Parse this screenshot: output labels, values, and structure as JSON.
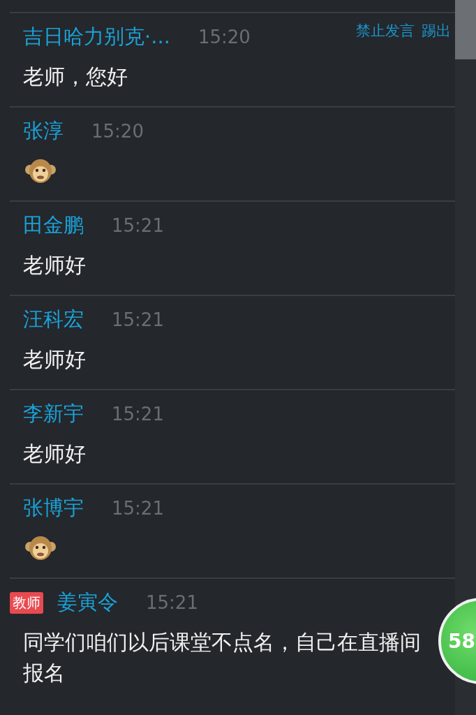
{
  "messages": [
    {
      "sender": "吉日哈力别克·...",
      "time": "15:20",
      "kind": "text",
      "body": "老师，您好",
      "actions": [
        "禁止发言",
        "踢出"
      ]
    },
    {
      "sender": "张淳",
      "time": "15:20",
      "kind": "sticker"
    },
    {
      "sender": "田金鹏",
      "time": "15:21",
      "kind": "text",
      "body": "老师好"
    },
    {
      "sender": "汪科宏",
      "time": "15:21",
      "kind": "text",
      "body": "老师好"
    },
    {
      "sender": "李新宇",
      "time": "15:21",
      "kind": "text",
      "body": "老师好"
    },
    {
      "sender": "张博宇",
      "time": "15:21",
      "kind": "sticker"
    },
    {
      "sender": "姜寅令",
      "time": "15:21",
      "kind": "text",
      "role": "教师",
      "body": "同学们咱们以后课堂不点名，自己在直播间报名"
    }
  ],
  "floating_badge": "58"
}
